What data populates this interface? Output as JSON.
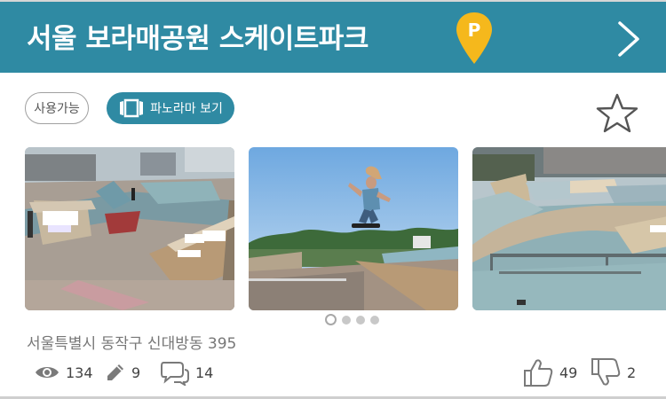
{
  "header": {
    "title": "서울 보라매공원 스케이트파크",
    "background_color": "#2f8aa3",
    "pin_icon": "parking-pin-icon",
    "pin_label": "P",
    "pin_color": "#f5b81c",
    "next_icon": "chevron-right-icon"
  },
  "badges": {
    "available_label": "사용가능",
    "panorama_label": "파노라마 보기",
    "panorama_icon": "panorama-icon"
  },
  "favorite_icon": "star-outline-icon",
  "gallery": {
    "photos": [
      "photo-1",
      "photo-2",
      "photo-3"
    ],
    "page_count": 4,
    "active_page": 1
  },
  "address": "서울특별시 동작구 신대방동 395",
  "stats": {
    "views": "134",
    "edits": "9",
    "comments": "14",
    "likes": "49",
    "dislikes": "2"
  }
}
